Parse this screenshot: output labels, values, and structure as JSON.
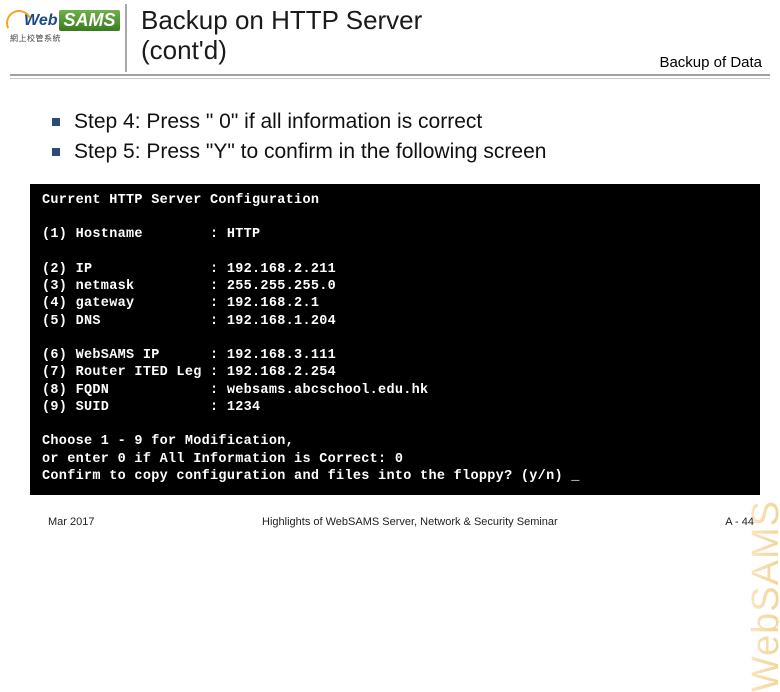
{
  "header": {
    "logo_web": "Web",
    "logo_sams": "SAMS",
    "logo_sub": "網上校管系統",
    "title_line1": "Backup on HTTP Server",
    "title_line2": "(cont'd)",
    "section": "Backup of Data"
  },
  "bullets": [
    "Step 4: Press \" 0\" if all information is correct",
    "Step 5: Press \"Y\" to confirm in the following screen"
  ],
  "terminal": {
    "heading": "Current HTTP Server Configuration",
    "rows": [
      {
        "label": "(1) Hostname",
        "value": "HTTP"
      },
      {
        "label": "",
        "value": ""
      },
      {
        "label": "(2) IP",
        "value": "192.168.2.211"
      },
      {
        "label": "(3) netmask",
        "value": "255.255.255.0"
      },
      {
        "label": "(4) gateway",
        "value": "192.168.2.1"
      },
      {
        "label": "(5) DNS",
        "value": "192.168.1.204"
      },
      {
        "label": "",
        "value": ""
      },
      {
        "label": "(6) WebSAMS IP",
        "value": "192.168.3.111"
      },
      {
        "label": "(7) Router ITED Leg",
        "value": "192.168.2.254"
      },
      {
        "label": "(8) FQDN",
        "value": "websams.abcschool.edu.hk"
      },
      {
        "label": "(9) SUID",
        "value": "1234"
      }
    ],
    "prompt1": "Choose 1 - 9 for Modification,",
    "prompt2": "or enter 0 if All Information is Correct: 0",
    "prompt3": "Confirm to copy configuration and files into the floppy? (y/n) _"
  },
  "footer": {
    "date": "Mar 2017",
    "center": "Highlights of WebSAMS Server, Network & Security Seminar",
    "page": "A - 44"
  },
  "watermark": "WebSAMS"
}
